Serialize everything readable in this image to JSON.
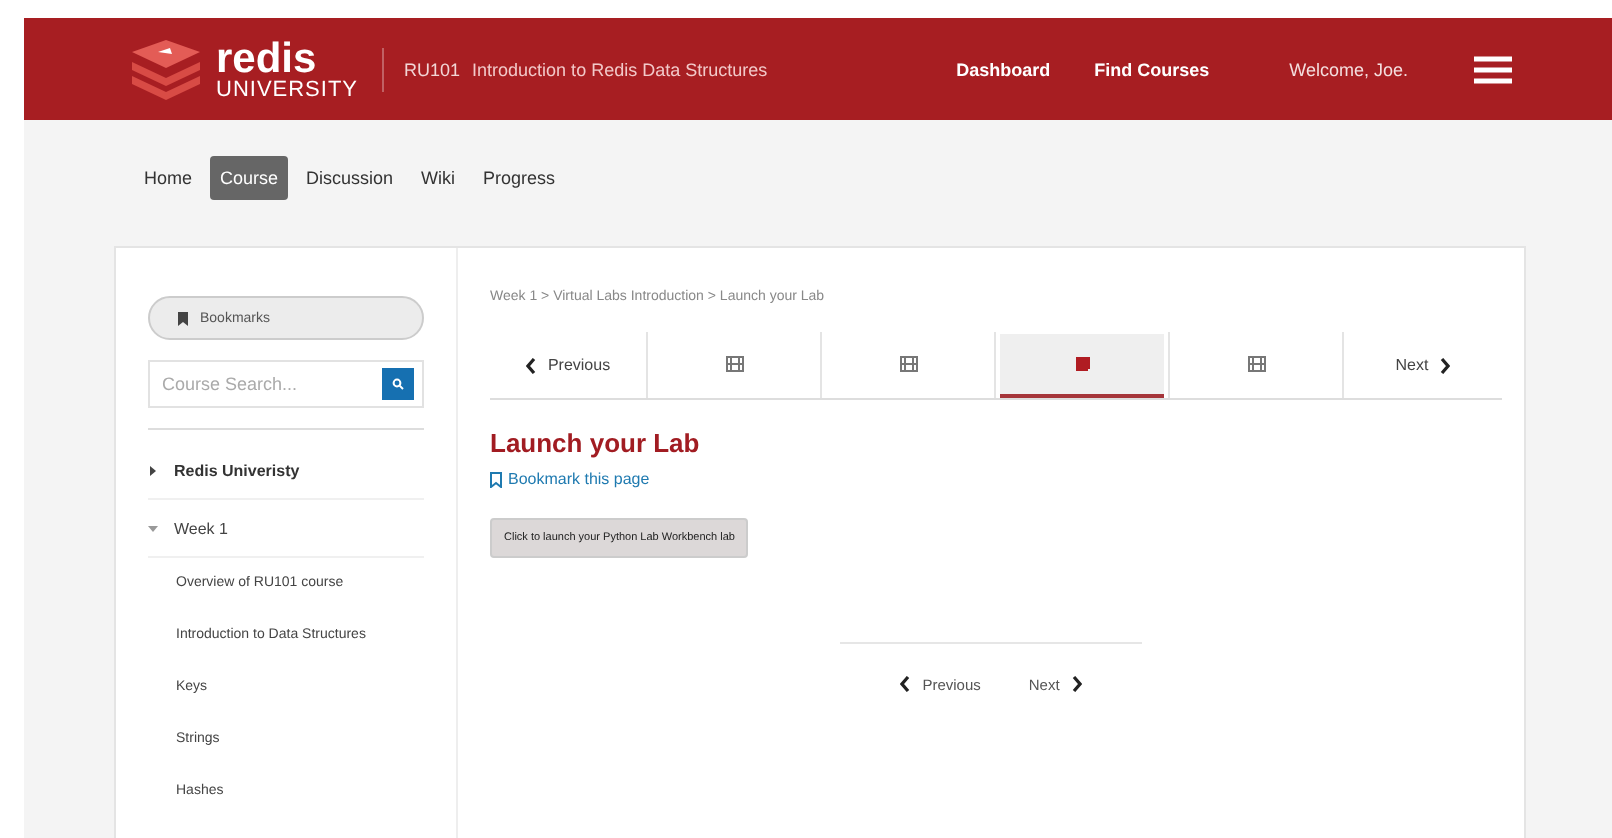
{
  "header": {
    "logo_top": "redis",
    "logo_bottom": "UNIVERSITY",
    "course_code": "RU101",
    "course_title": "Introduction to Redis Data Structures",
    "links": [
      "Dashboard",
      "Find Courses"
    ],
    "welcome": "Welcome, Joe."
  },
  "nav_tabs": [
    {
      "label": "Home",
      "selected": false
    },
    {
      "label": "Course",
      "selected": true
    },
    {
      "label": "Discussion",
      "selected": false
    },
    {
      "label": "Wiki",
      "selected": false
    },
    {
      "label": "Progress",
      "selected": false
    }
  ],
  "sidebar": {
    "bookmarks": "Bookmarks",
    "search": {
      "placeholder": "Course Search..."
    },
    "sections": [
      {
        "label": "Redis Univeristy",
        "expanded": false
      },
      {
        "label": "Week 1",
        "expanded": true,
        "children": [
          {
            "label": "Overview of RU101 course"
          },
          {
            "label": "Introduction to Data Structures"
          },
          {
            "label": "Keys"
          },
          {
            "label": "Strings"
          },
          {
            "label": "Hashes"
          }
        ]
      }
    ]
  },
  "breadcrumb": "Week 1 > Virtual Labs Introduction > Launch your Lab",
  "sequence": {
    "previous": "Previous",
    "next": "Next",
    "units": [
      {
        "kind": "video",
        "selected": false
      },
      {
        "kind": "video",
        "selected": false
      },
      {
        "kind": "problem",
        "selected": true
      },
      {
        "kind": "video",
        "selected": false
      }
    ]
  },
  "unit_title": "Launch your Lab",
  "bookmark_link": "Bookmark this page",
  "launch_button": "Click to launch your Python Lab Workbench lab",
  "bottom_nav": {
    "previous": "Previous",
    "next": "Next"
  }
}
